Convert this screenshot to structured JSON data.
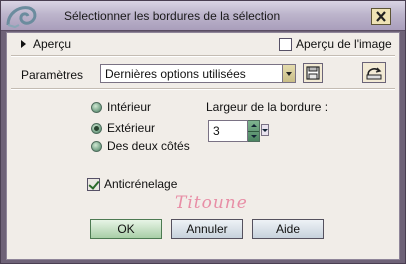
{
  "window": {
    "title": "Sélectionner les bordures de la sélection"
  },
  "preview": {
    "toggle_label": "Aperçu",
    "image_preview_label": "Aperçu de l'image",
    "image_preview_checked": false
  },
  "presets": {
    "label": "Paramètres",
    "selected": "Dernières options utilisées"
  },
  "position": {
    "options": [
      "Intérieur",
      "Extérieur",
      "Des deux côtés"
    ],
    "selected": "Extérieur"
  },
  "border_width": {
    "label": "Largeur de la bordure :",
    "value": "3"
  },
  "antialias": {
    "label": "Anticrénelage",
    "checked": true
  },
  "watermark": {
    "text": "Titoune"
  },
  "buttons": {
    "ok": "OK",
    "cancel": "Annuler",
    "help": "Aide"
  },
  "icons": {
    "app": "shell-icon",
    "close": "close-icon",
    "save": "save-preset-icon",
    "reset": "reset-icon"
  },
  "colors": {
    "frame": "#6e6277",
    "client": "#f1ede8",
    "titlebar": "#bdb5cc",
    "ok_button": "#a9cfa7",
    "watermark": "#e88ea6"
  }
}
